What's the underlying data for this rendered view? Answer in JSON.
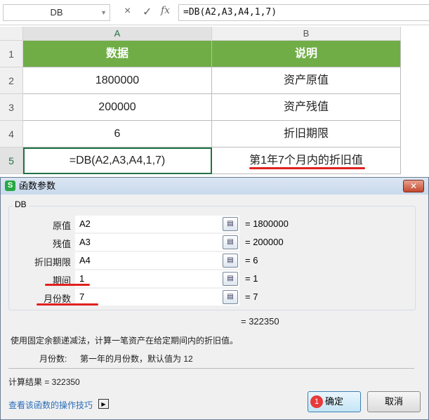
{
  "formula_bar": {
    "name_box": "DB",
    "cancel_icon": "×",
    "enter_icon": "✓",
    "fx_icon": "fx",
    "formula": "=DB(A2,A3,A4,1,7)"
  },
  "columns": [
    "A",
    "B"
  ],
  "rows": [
    {
      "num": "1",
      "a": "数据",
      "b": "说明"
    },
    {
      "num": "2",
      "a": "1800000",
      "b": "资产原值"
    },
    {
      "num": "3",
      "a": "200000",
      "b": "资产残值"
    },
    {
      "num": "4",
      "a": "6",
      "b": "折旧期限"
    },
    {
      "num": "5",
      "a": "=DB(A2,A3,A4,1,7)",
      "b": "第1年7个月内的折旧值"
    }
  ],
  "dialog": {
    "title": "函数参数",
    "function_name": "DB",
    "args": [
      {
        "label": "原值",
        "value": "A2",
        "result": "=  1800000"
      },
      {
        "label": "残值",
        "value": "A3",
        "result": "=  200000"
      },
      {
        "label": "折旧期限",
        "value": "A4",
        "result": "=  6"
      },
      {
        "label": "期间",
        "value": "1",
        "result": "=  1"
      },
      {
        "label": "月份数",
        "value": "7",
        "result": "=  7"
      }
    ],
    "formula_result": "=  322350",
    "description": "使用固定余额递减法，计算一笔资产在给定期间内的折旧值。",
    "arg_help_label": "月份数:",
    "arg_help": "第一年的月份数，默认值为 12",
    "calc_result": "计算结果  =  322350",
    "help_link": "查看该函数的操作技巧",
    "ok": "确定",
    "cancel": "取消",
    "step_badge": "1"
  },
  "colors": {
    "header_fill": "#70ad47",
    "annotation": "#e0201e"
  }
}
